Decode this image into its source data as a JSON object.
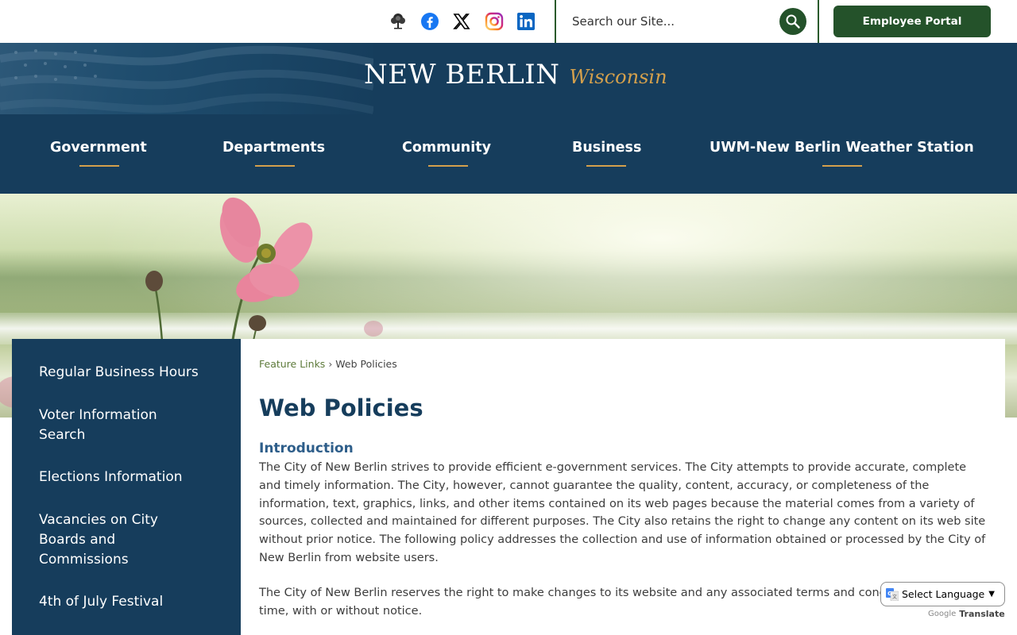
{
  "topbar": {
    "social": [
      {
        "name": "tree-icon"
      },
      {
        "name": "facebook-icon",
        "color": "#1877f2"
      },
      {
        "name": "x-icon",
        "color": "#000000"
      },
      {
        "name": "instagram-icon",
        "color": "#d62976"
      },
      {
        "name": "linkedin-icon",
        "color": "#0a66c2"
      }
    ],
    "search_placeholder": "Search our Site...",
    "employee_portal_label": "Employee Portal"
  },
  "header": {
    "logo_main": "NEW BERLIN",
    "logo_sub": "Wisconsin",
    "nav": [
      {
        "label": "Government"
      },
      {
        "label": "Departments"
      },
      {
        "label": "Community"
      },
      {
        "label": "Business"
      },
      {
        "label": "UWM-New Berlin Weather Station"
      }
    ],
    "accent_color": "#d4a04c",
    "background_color": "#163d5c"
  },
  "sidebar": {
    "items": [
      {
        "label": "Regular Business Hours"
      },
      {
        "label": "Voter Information Search"
      },
      {
        "label": "Elections Information"
      },
      {
        "label": "Vacancies on City Boards and Commissions"
      },
      {
        "label": "4th of July Festival"
      }
    ]
  },
  "content": {
    "breadcrumb": {
      "parent": "Feature Links",
      "separator": "›",
      "current": "Web Policies"
    },
    "title": "Web Policies",
    "section_heading": "Introduction",
    "paragraph_1": "The City of New Berlin strives to provide efficient e-government services. The City attempts to provide accurate, complete and timely information. The City, however, cannot guarantee the quality, content, accuracy, or completeness of the information, text, graphics, links, and other items contained on its web pages because the material comes from a variety of sources, collected and maintained for different purposes. The City also retains the right to change any content on its web site without prior notice. The following policy addresses the collection and use of information obtained or processed by the City of New Berlin from website users.",
    "paragraph_2": "The City of New Berlin reserves the right to make changes to its website and any associated terms and conditions at any time, with or without notice."
  },
  "translate": {
    "select_label": "Select Language",
    "powered_by": "Google",
    "translate_label": "Translate"
  }
}
